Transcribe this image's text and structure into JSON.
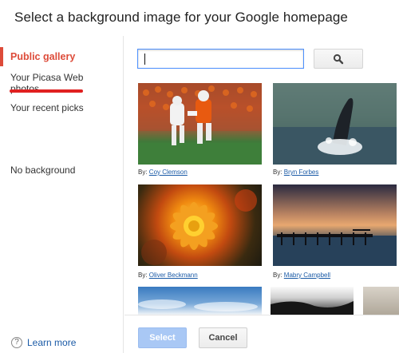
{
  "dialog": {
    "title": "Select a background image for your Google homepage"
  },
  "sidebar": {
    "items": [
      {
        "label": "Public gallery",
        "active": true
      },
      {
        "label": "Your Picasa Web photos"
      },
      {
        "label": "Your recent picks"
      },
      {
        "label": "No background"
      }
    ],
    "learn_more": "Learn more",
    "help_icon": "?"
  },
  "search": {
    "value": "",
    "placeholder": "",
    "button_icon": "search-icon"
  },
  "gallery": {
    "images": [
      {
        "subject": "football players",
        "by_label": "By:",
        "author": "Coy Clemson"
      },
      {
        "subject": "whale breaching",
        "by_label": "By:",
        "author": "Bryn Forbes"
      },
      {
        "subject": "orange flower",
        "by_label": "By:",
        "author": "Oliver Beckmann"
      },
      {
        "subject": "pier at sunset",
        "by_label": "By:",
        "author": "Mabry Campbell"
      },
      {
        "subject": "blue sky landscape"
      },
      {
        "subject": "black and white landscape"
      },
      {
        "subject": "partial image"
      }
    ]
  },
  "footer": {
    "select_label": "Select",
    "cancel_label": "Cancel"
  },
  "colors": {
    "accent": "#dd4b39",
    "link": "#1a5aa6",
    "annotation": "#e02020"
  }
}
